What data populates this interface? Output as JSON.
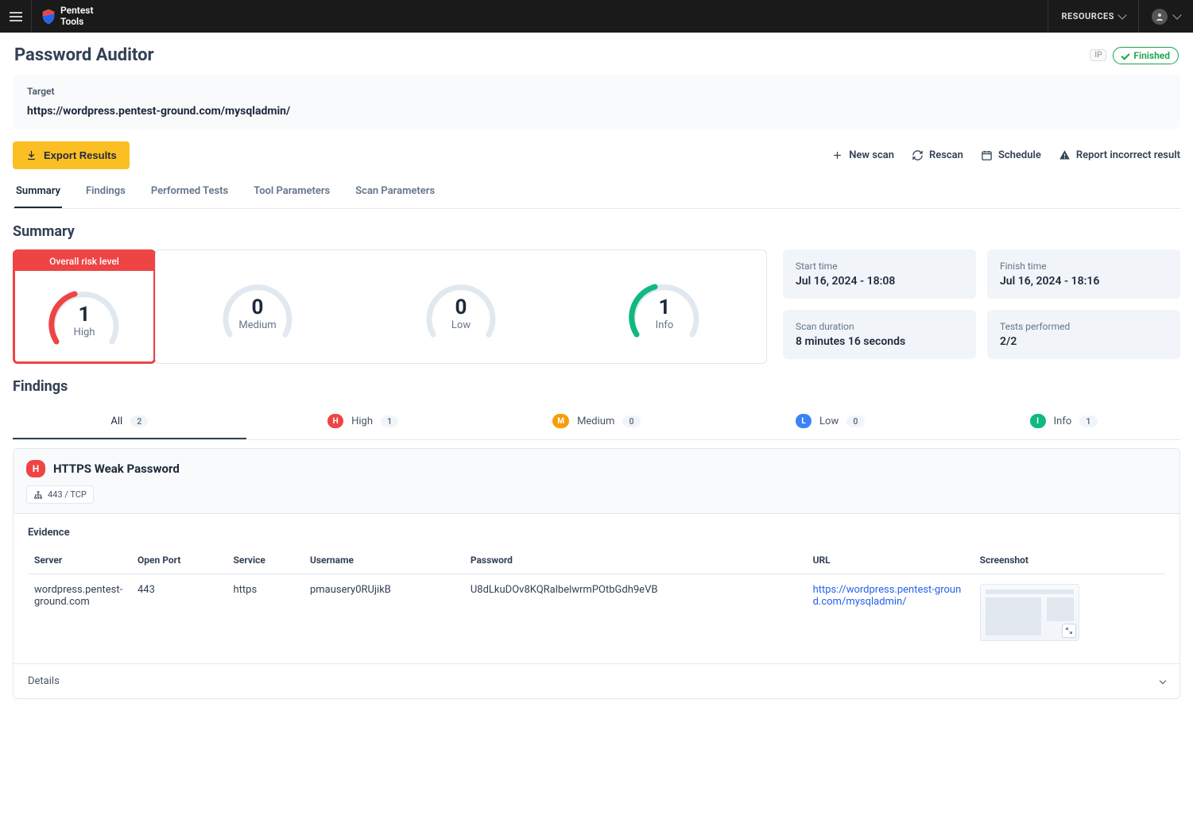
{
  "topbar": {
    "resources_label": "RESOURCES",
    "logo_line1": "Pentest",
    "logo_line2": "Tools"
  },
  "page": {
    "title": "Password Auditor",
    "ip_badge": "IP",
    "status": "Finished"
  },
  "target": {
    "label": "Target",
    "url": "https://wordpress.pentest-ground.com/mysqladmin/"
  },
  "actions": {
    "export": "Export Results",
    "new_scan": "New scan",
    "rescan": "Rescan",
    "schedule": "Schedule",
    "report": "Report incorrect result"
  },
  "tabs": {
    "summary": "Summary",
    "findings": "Findings",
    "performed": "Performed Tests",
    "tool_params": "Tool Parameters",
    "scan_params": "Scan Parameters"
  },
  "summary": {
    "heading": "Summary",
    "risk_heading": "Overall risk level",
    "high": {
      "value": "1",
      "label": "High"
    },
    "medium": {
      "value": "0",
      "label": "Medium"
    },
    "low": {
      "value": "0",
      "label": "Low"
    },
    "info": {
      "value": "1",
      "label": "Info"
    },
    "start_label": "Start time",
    "start_value": "Jul 16, 2024 - 18:08",
    "finish_label": "Finish time",
    "finish_value": "Jul 16, 2024 - 18:16",
    "duration_label": "Scan duration",
    "duration_value": "8 minutes 16 seconds",
    "tests_label": "Tests performed",
    "tests_value": "2/2"
  },
  "findings_section": {
    "heading": "Findings",
    "filters": {
      "all": {
        "label": "All",
        "count": "2"
      },
      "high": {
        "label": "High",
        "count": "1"
      },
      "medium": {
        "label": "Medium",
        "count": "0"
      },
      "low": {
        "label": "Low",
        "count": "0"
      },
      "info": {
        "label": "Info",
        "count": "1"
      }
    },
    "item": {
      "severity_letter": "H",
      "title": "HTTPS Weak Password",
      "port": "443 / TCP",
      "evidence_label": "Evidence",
      "columns": {
        "server": "Server",
        "open_port": "Open Port",
        "service": "Service",
        "username": "Username",
        "password": "Password",
        "url": "URL",
        "screenshot": "Screenshot"
      },
      "row": {
        "server": "wordpress.pentest-ground.com",
        "open_port": "443",
        "service": "https",
        "username": "pmausery0RUjikB",
        "password": "U8dLkuDOv8KQRalbelwrmPOtbGdh9eVB",
        "url": "https://wordpress.pentest-ground.com/mysqladmin/"
      },
      "details_label": "Details"
    }
  }
}
